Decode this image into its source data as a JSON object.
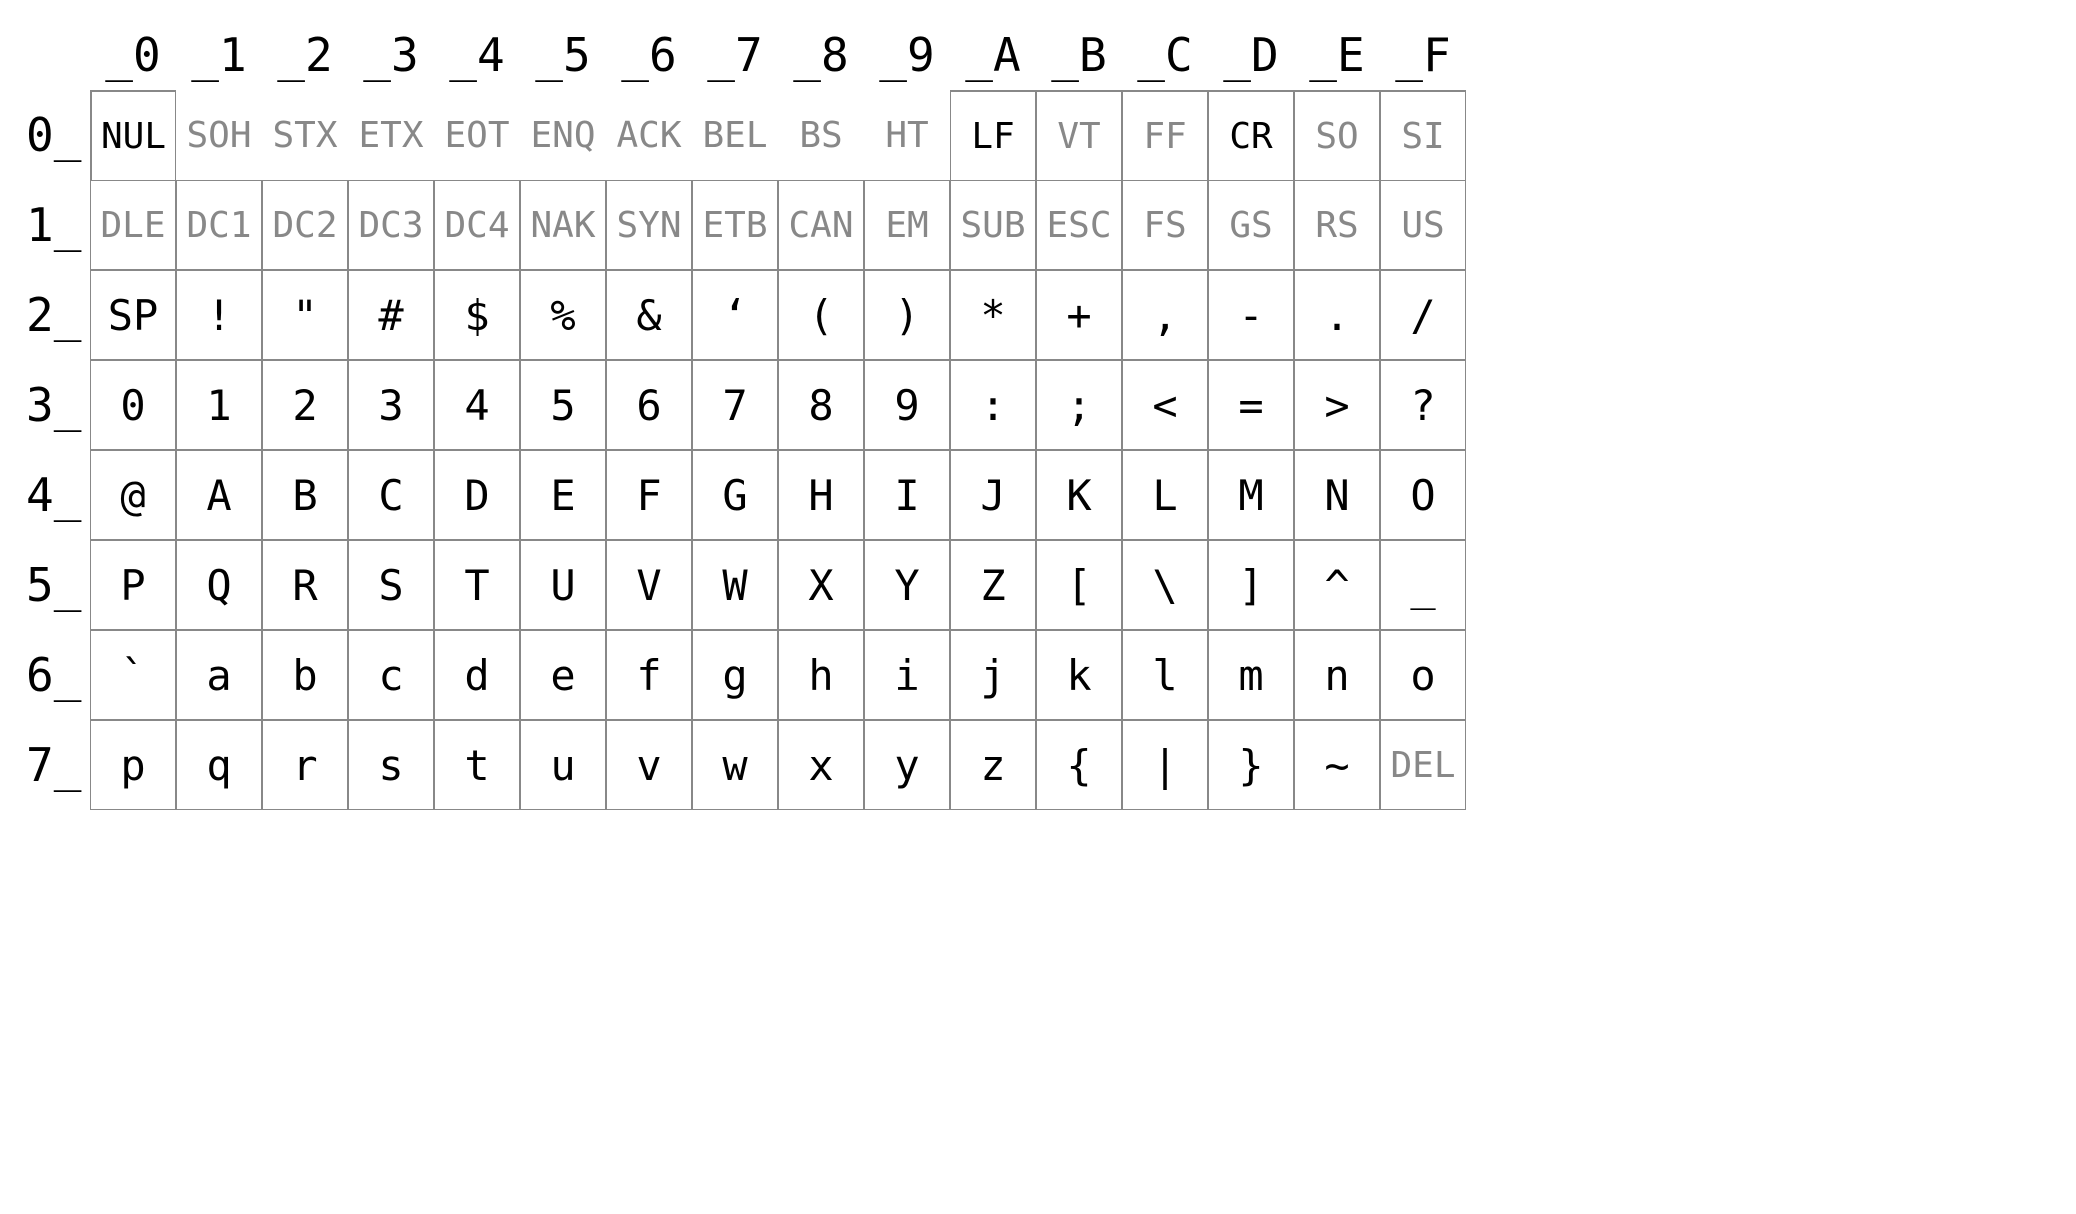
{
  "col_headers": [
    "_0",
    "_1",
    "_2",
    "_3",
    "_4",
    "_5",
    "_6",
    "_7",
    "_8",
    "_9",
    "_A",
    "_B",
    "_C",
    "_D",
    "_E",
    "_F"
  ],
  "row_headers": [
    "0_",
    "1_",
    "2_",
    "3_",
    "4_",
    "5_",
    "6_",
    "7_"
  ],
  "rows": [
    [
      {
        "t": "NUL",
        "c": "ctrl emph",
        "b": "r0c0"
      },
      {
        "t": "SOH",
        "c": "ctrl",
        "b": "r0noborder"
      },
      {
        "t": "STX",
        "c": "ctrl",
        "b": "r0noborder"
      },
      {
        "t": "ETX",
        "c": "ctrl",
        "b": "r0noborder"
      },
      {
        "t": "EOT",
        "c": "ctrl",
        "b": "r0noborder"
      },
      {
        "t": "ENQ",
        "c": "ctrl",
        "b": "r0noborder"
      },
      {
        "t": "ACK",
        "c": "ctrl",
        "b": "r0noborder"
      },
      {
        "t": "BEL",
        "c": "ctrl",
        "b": "r0noborder"
      },
      {
        "t": "BS",
        "c": "ctrl",
        "b": "r0noborder"
      },
      {
        "t": "HT",
        "c": "ctrl",
        "b": "r0noborder"
      },
      {
        "t": "LF",
        "c": "ctrl emph",
        "b": "r0atoF"
      },
      {
        "t": "VT",
        "c": "ctrl",
        "b": "r0atoF"
      },
      {
        "t": "FF",
        "c": "ctrl",
        "b": "r0atoF"
      },
      {
        "t": "CR",
        "c": "ctrl emph",
        "b": "r0atoF"
      },
      {
        "t": "SO",
        "c": "ctrl",
        "b": "r0atoF"
      },
      {
        "t": "SI",
        "c": "ctrl",
        "b": "r0atoF"
      }
    ],
    [
      {
        "t": "DLE",
        "c": "ctrl"
      },
      {
        "t": "DC1",
        "c": "ctrl"
      },
      {
        "t": "DC2",
        "c": "ctrl"
      },
      {
        "t": "DC3",
        "c": "ctrl"
      },
      {
        "t": "DC4",
        "c": "ctrl"
      },
      {
        "t": "NAK",
        "c": "ctrl"
      },
      {
        "t": "SYN",
        "c": "ctrl"
      },
      {
        "t": "ETB",
        "c": "ctrl"
      },
      {
        "t": "CAN",
        "c": "ctrl"
      },
      {
        "t": "EM",
        "c": "ctrl"
      },
      {
        "t": "SUB",
        "c": "ctrl"
      },
      {
        "t": "ESC",
        "c": "ctrl"
      },
      {
        "t": "FS",
        "c": "ctrl"
      },
      {
        "t": "GS",
        "c": "ctrl"
      },
      {
        "t": "RS",
        "c": "ctrl"
      },
      {
        "t": "US",
        "c": "ctrl"
      }
    ],
    [
      {
        "t": "SP",
        "c": "printable"
      },
      {
        "t": "!",
        "c": "printable"
      },
      {
        "t": "\"",
        "c": "printable"
      },
      {
        "t": "#",
        "c": "printable"
      },
      {
        "t": "$",
        "c": "printable"
      },
      {
        "t": "%",
        "c": "printable"
      },
      {
        "t": "&",
        "c": "printable"
      },
      {
        "t": "‘",
        "c": "printable"
      },
      {
        "t": "(",
        "c": "printable"
      },
      {
        "t": ")",
        "c": "printable"
      },
      {
        "t": "*",
        "c": "printable"
      },
      {
        "t": "+",
        "c": "printable"
      },
      {
        "t": ",",
        "c": "printable"
      },
      {
        "t": "-",
        "c": "printable"
      },
      {
        "t": ".",
        "c": "printable"
      },
      {
        "t": "/",
        "c": "printable"
      }
    ],
    [
      {
        "t": "0",
        "c": "printable"
      },
      {
        "t": "1",
        "c": "printable"
      },
      {
        "t": "2",
        "c": "printable"
      },
      {
        "t": "3",
        "c": "printable"
      },
      {
        "t": "4",
        "c": "printable"
      },
      {
        "t": "5",
        "c": "printable"
      },
      {
        "t": "6",
        "c": "printable"
      },
      {
        "t": "7",
        "c": "printable"
      },
      {
        "t": "8",
        "c": "printable"
      },
      {
        "t": "9",
        "c": "printable"
      },
      {
        "t": ":",
        "c": "printable"
      },
      {
        "t": ";",
        "c": "printable"
      },
      {
        "t": "<",
        "c": "printable"
      },
      {
        "t": "=",
        "c": "printable"
      },
      {
        "t": ">",
        "c": "printable"
      },
      {
        "t": "?",
        "c": "printable"
      }
    ],
    [
      {
        "t": "@",
        "c": "printable"
      },
      {
        "t": "A",
        "c": "printable"
      },
      {
        "t": "B",
        "c": "printable"
      },
      {
        "t": "C",
        "c": "printable"
      },
      {
        "t": "D",
        "c": "printable"
      },
      {
        "t": "E",
        "c": "printable"
      },
      {
        "t": "F",
        "c": "printable"
      },
      {
        "t": "G",
        "c": "printable"
      },
      {
        "t": "H",
        "c": "printable"
      },
      {
        "t": "I",
        "c": "printable"
      },
      {
        "t": "J",
        "c": "printable"
      },
      {
        "t": "K",
        "c": "printable"
      },
      {
        "t": "L",
        "c": "printable"
      },
      {
        "t": "M",
        "c": "printable"
      },
      {
        "t": "N",
        "c": "printable"
      },
      {
        "t": "O",
        "c": "printable"
      }
    ],
    [
      {
        "t": "P",
        "c": "printable"
      },
      {
        "t": "Q",
        "c": "printable"
      },
      {
        "t": "R",
        "c": "printable"
      },
      {
        "t": "S",
        "c": "printable"
      },
      {
        "t": "T",
        "c": "printable"
      },
      {
        "t": "U",
        "c": "printable"
      },
      {
        "t": "V",
        "c": "printable"
      },
      {
        "t": "W",
        "c": "printable"
      },
      {
        "t": "X",
        "c": "printable"
      },
      {
        "t": "Y",
        "c": "printable"
      },
      {
        "t": "Z",
        "c": "printable"
      },
      {
        "t": "[",
        "c": "printable"
      },
      {
        "t": "\\",
        "c": "printable"
      },
      {
        "t": "]",
        "c": "printable"
      },
      {
        "t": "^",
        "c": "printable"
      },
      {
        "t": "_",
        "c": "printable"
      }
    ],
    [
      {
        "t": "`",
        "c": "printable"
      },
      {
        "t": "a",
        "c": "printable"
      },
      {
        "t": "b",
        "c": "printable"
      },
      {
        "t": "c",
        "c": "printable"
      },
      {
        "t": "d",
        "c": "printable"
      },
      {
        "t": "e",
        "c": "printable"
      },
      {
        "t": "f",
        "c": "printable"
      },
      {
        "t": "g",
        "c": "printable"
      },
      {
        "t": "h",
        "c": "printable"
      },
      {
        "t": "i",
        "c": "printable"
      },
      {
        "t": "j",
        "c": "printable"
      },
      {
        "t": "k",
        "c": "printable"
      },
      {
        "t": "l",
        "c": "printable"
      },
      {
        "t": "m",
        "c": "printable"
      },
      {
        "t": "n",
        "c": "printable"
      },
      {
        "t": "o",
        "c": "printable"
      }
    ],
    [
      {
        "t": "p",
        "c": "printable"
      },
      {
        "t": "q",
        "c": "printable"
      },
      {
        "t": "r",
        "c": "printable"
      },
      {
        "t": "s",
        "c": "printable"
      },
      {
        "t": "t",
        "c": "printable"
      },
      {
        "t": "u",
        "c": "printable"
      },
      {
        "t": "v",
        "c": "printable"
      },
      {
        "t": "w",
        "c": "printable"
      },
      {
        "t": "x",
        "c": "printable"
      },
      {
        "t": "y",
        "c": "printable"
      },
      {
        "t": "z",
        "c": "printable"
      },
      {
        "t": "{",
        "c": "printable"
      },
      {
        "t": "|",
        "c": "printable"
      },
      {
        "t": "}",
        "c": "printable"
      },
      {
        "t": "~",
        "c": "printable"
      },
      {
        "t": "DEL",
        "c": "ctrl"
      }
    ]
  ]
}
